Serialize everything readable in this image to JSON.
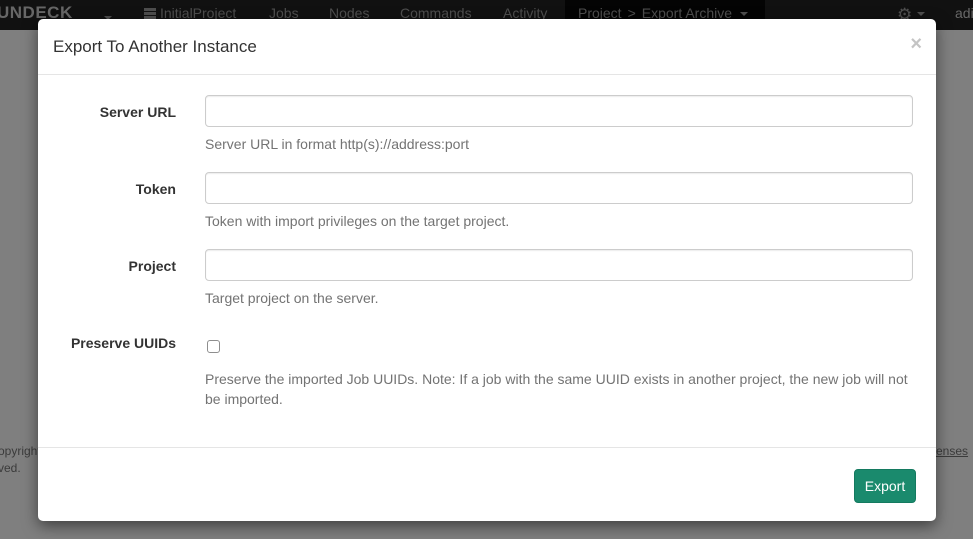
{
  "navbar": {
    "brand": "UNDECK",
    "project_switcher": "InitialProject",
    "links": [
      "Jobs",
      "Nodes",
      "Commands",
      "Activity"
    ],
    "breadcrumb_project": "Project",
    "breadcrumb_page": "Export Archive",
    "user": "adi"
  },
  "footer": {
    "left_line1": "opyright",
    "left_line2": "ved.",
    "right_link": "enses"
  },
  "modal": {
    "title": "Export To Another Instance",
    "close_symbol": "×",
    "fields": {
      "server_url": {
        "label": "Server URL",
        "value": "",
        "help": "Server URL in format http(s)://address:port"
      },
      "token": {
        "label": "Token",
        "value": "",
        "help": "Token with import privileges on the target project."
      },
      "project": {
        "label": "Project",
        "value": "",
        "help": "Target project on the server."
      },
      "preserve_uuids": {
        "label": "Preserve UUIDs",
        "checked": false,
        "help": "Preserve the imported Job UUIDs. Note: If a job with the same UUID exists in another project, the new job will not be imported."
      }
    },
    "export_label": "Export"
  },
  "colors": {
    "navbar_bg": "#222222",
    "export_button": "#1a8a6d",
    "overlay": "rgba(0,0,0,0.5)"
  }
}
